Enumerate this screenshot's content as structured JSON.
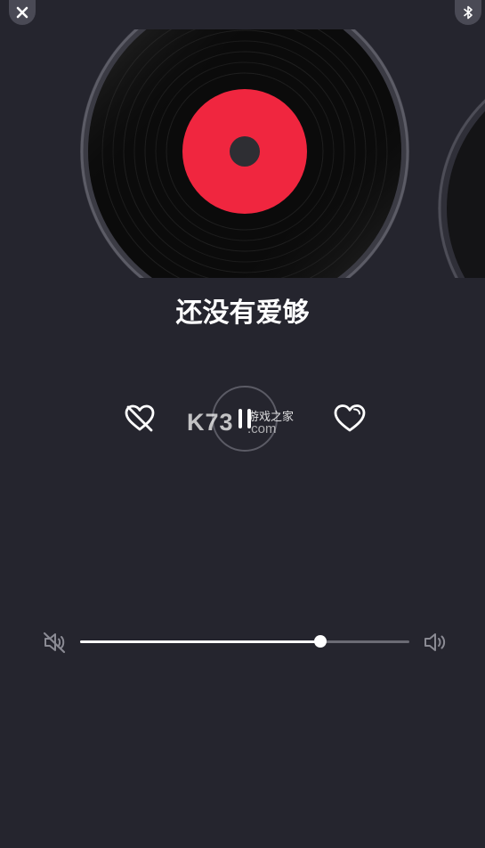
{
  "top_bar": {
    "close_icon": "close-icon",
    "bluetooth_icon": "bluetooth-icon"
  },
  "player": {
    "song_title": "还没有爱够",
    "state": "playing",
    "dislike_icon": "heart-broken-icon",
    "play_pause_icon": "pause-icon",
    "like_icon": "heart-icon"
  },
  "watermark": {
    "brand": "K73",
    "domain": ".com",
    "name": "游戏之家"
  },
  "volume": {
    "level": 0.73,
    "mute_icon": "volume-mute-icon",
    "max_icon": "volume-up-icon"
  },
  "colors": {
    "background": "#25252e",
    "record_label": "#f0263f",
    "control_icon": "#ffffff",
    "volume_track": "#6b6b74"
  }
}
